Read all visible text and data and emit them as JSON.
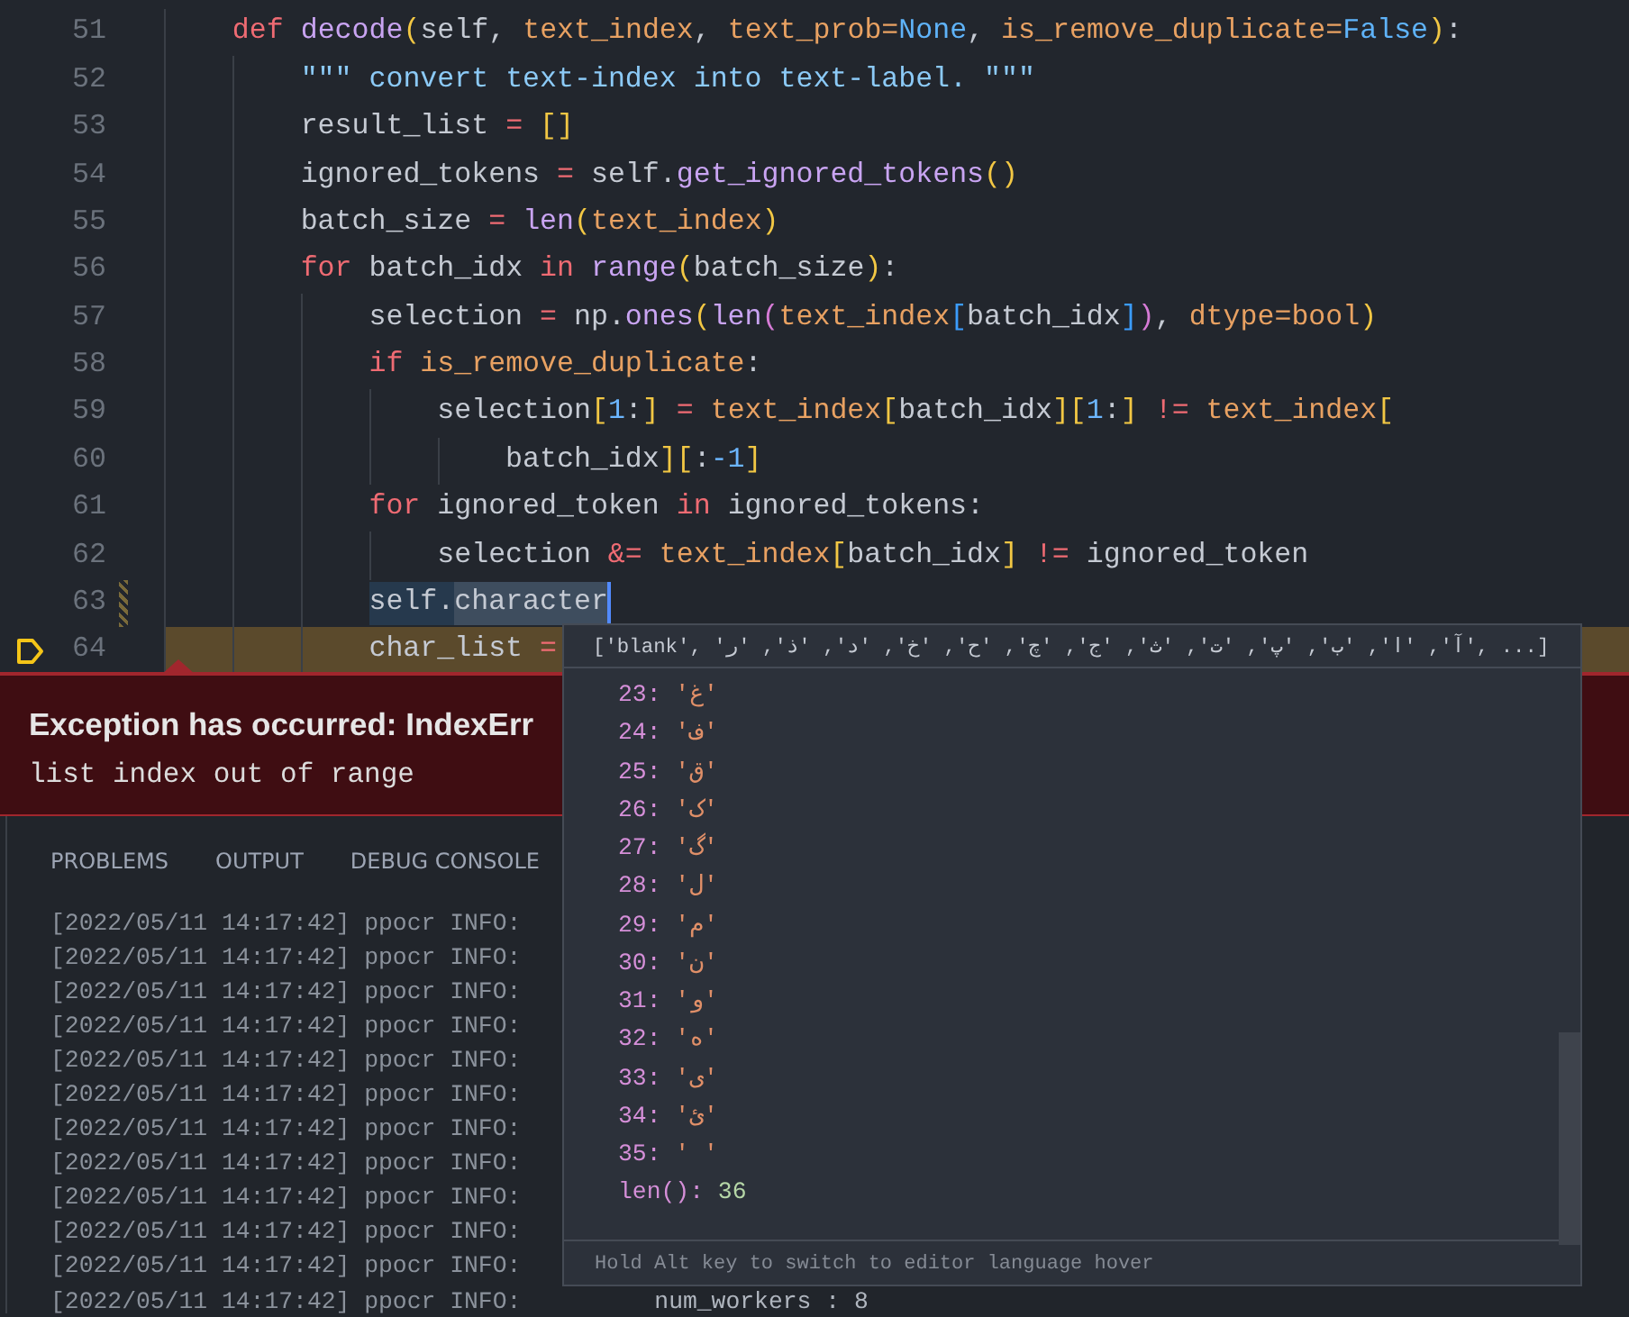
{
  "editor": {
    "lines": [
      {
        "number": "51",
        "modified": false,
        "paused": false,
        "tokens": [
          {
            "text": "def",
            "kind": "kw"
          },
          {
            "text": " decode",
            "kind": "fn"
          },
          {
            "text": "(",
            "kind": "b1"
          },
          {
            "text": "self, ",
            "kind": "plain"
          },
          {
            "text": "text_index",
            "kind": "param"
          },
          {
            "text": ", ",
            "kind": "plain"
          },
          {
            "text": "text_prob=",
            "kind": "param"
          },
          {
            "text": "None",
            "kind": "const"
          },
          {
            "text": ", ",
            "kind": "plain"
          },
          {
            "text": "is_remove_duplicate=",
            "kind": "param"
          },
          {
            "text": "False",
            "kind": "const"
          },
          {
            "text": ")",
            "kind": "b1"
          },
          {
            "text": ":",
            "kind": "plain"
          }
        ],
        "children": [
          {
            "number": "52",
            "modified": false,
            "paused": false,
            "tokens": [
              {
                "text": "\"\"\" convert text-index into text-label. \"\"\"",
                "kind": "str"
              }
            ]
          },
          {
            "number": "53",
            "modified": false,
            "paused": false,
            "tokens": [
              {
                "text": "result_list ",
                "kind": "plain"
              },
              {
                "text": "= ",
                "kind": "op"
              },
              {
                "text": "[]",
                "kind": "b1"
              }
            ]
          },
          {
            "number": "54",
            "modified": false,
            "paused": false,
            "tokens": [
              {
                "text": "ignored_tokens ",
                "kind": "plain"
              },
              {
                "text": "=",
                "kind": "op"
              },
              {
                "text": " self.",
                "kind": "plain"
              },
              {
                "text": "get_ignored_tokens",
                "kind": "fn"
              },
              {
                "text": "()",
                "kind": "b1"
              }
            ]
          },
          {
            "number": "55",
            "modified": false,
            "paused": false,
            "tokens": [
              {
                "text": "batch_size ",
                "kind": "plain"
              },
              {
                "text": "= ",
                "kind": "op"
              },
              {
                "text": "len",
                "kind": "fn"
              },
              {
                "text": "(",
                "kind": "b1"
              },
              {
                "text": "text_index",
                "kind": "param"
              },
              {
                "text": ")",
                "kind": "b1"
              }
            ]
          },
          {
            "number": "56",
            "modified": false,
            "paused": false,
            "tokens": [
              {
                "text": "for",
                "kind": "kw"
              },
              {
                "text": " batch_idx ",
                "kind": "plain"
              },
              {
                "text": "in",
                "kind": "kw"
              },
              {
                "text": " range",
                "kind": "fn"
              },
              {
                "text": "(",
                "kind": "b1"
              },
              {
                "text": "batch_size",
                "kind": "plain"
              },
              {
                "text": ")",
                "kind": "b1"
              },
              {
                "text": ":",
                "kind": "plain"
              }
            ],
            "children": [
              {
                "number": "57",
                "modified": false,
                "paused": false,
                "tokens": [
                  {
                    "text": "selection ",
                    "kind": "plain"
                  },
                  {
                    "text": "=",
                    "kind": "op"
                  },
                  {
                    "text": " np.",
                    "kind": "plain"
                  },
                  {
                    "text": "ones",
                    "kind": "fn"
                  },
                  {
                    "text": "(",
                    "kind": "b1"
                  },
                  {
                    "text": "len",
                    "kind": "fn"
                  },
                  {
                    "text": "(",
                    "kind": "b2"
                  },
                  {
                    "text": "text_index",
                    "kind": "param"
                  },
                  {
                    "text": "[",
                    "kind": "b3"
                  },
                  {
                    "text": "batch_idx",
                    "kind": "plain"
                  },
                  {
                    "text": "]",
                    "kind": "b3"
                  },
                  {
                    "text": ")",
                    "kind": "b2"
                  },
                  {
                    "text": ", ",
                    "kind": "plain"
                  },
                  {
                    "text": "dtype=bool",
                    "kind": "param"
                  },
                  {
                    "text": ")",
                    "kind": "b1"
                  }
                ]
              },
              {
                "number": "58",
                "modified": false,
                "paused": false,
                "tokens": [
                  {
                    "text": "if",
                    "kind": "kw"
                  },
                  {
                    "text": " is_remove_duplicate",
                    "kind": "param"
                  },
                  {
                    "text": ":",
                    "kind": "plain"
                  }
                ],
                "children": [
                  {
                    "number": "59",
                    "modified": false,
                    "paused": false,
                    "tokens": [
                      {
                        "text": "selection",
                        "kind": "plain"
                      },
                      {
                        "text": "[",
                        "kind": "b1"
                      },
                      {
                        "text": "1",
                        "kind": "num"
                      },
                      {
                        "text": ":",
                        "kind": "plain"
                      },
                      {
                        "text": "]",
                        "kind": "b1"
                      },
                      {
                        "text": " = ",
                        "kind": "op"
                      },
                      {
                        "text": "text_index",
                        "kind": "param"
                      },
                      {
                        "text": "[",
                        "kind": "b1"
                      },
                      {
                        "text": "batch_idx",
                        "kind": "plain"
                      },
                      {
                        "text": "][",
                        "kind": "b1"
                      },
                      {
                        "text": "1",
                        "kind": "num"
                      },
                      {
                        "text": ":",
                        "kind": "plain"
                      },
                      {
                        "text": "]",
                        "kind": "b1"
                      },
                      {
                        "text": " != ",
                        "kind": "op"
                      },
                      {
                        "text": "text_index",
                        "kind": "param"
                      },
                      {
                        "text": "[",
                        "kind": "b1"
                      }
                    ],
                    "children": [
                      {
                        "number": "60",
                        "modified": false,
                        "paused": false,
                        "tokens": [
                          {
                            "text": "batch_idx",
                            "kind": "plain"
                          },
                          {
                            "text": "][",
                            "kind": "b1"
                          },
                          {
                            "text": ":",
                            "kind": "plain"
                          },
                          {
                            "text": "-1",
                            "kind": "num"
                          },
                          {
                            "text": "]",
                            "kind": "b1"
                          }
                        ]
                      }
                    ]
                  }
                ]
              },
              {
                "number": "61",
                "modified": false,
                "paused": false,
                "tokens": [
                  {
                    "text": "for",
                    "kind": "kw"
                  },
                  {
                    "text": " ignored_token ",
                    "kind": "plain"
                  },
                  {
                    "text": "in",
                    "kind": "kw"
                  },
                  {
                    "text": " ignored_tokens:",
                    "kind": "plain"
                  }
                ],
                "children": [
                  {
                    "number": "62",
                    "modified": false,
                    "paused": false,
                    "tokens": [
                      {
                        "text": "selection ",
                        "kind": "plain"
                      },
                      {
                        "text": "&= ",
                        "kind": "op"
                      },
                      {
                        "text": "text_index",
                        "kind": "param"
                      },
                      {
                        "text": "[",
                        "kind": "b1"
                      },
                      {
                        "text": "batch_idx",
                        "kind": "plain"
                      },
                      {
                        "text": "]",
                        "kind": "b1"
                      },
                      {
                        "text": " != ",
                        "kind": "op"
                      },
                      {
                        "text": "ignored_token",
                        "kind": "plain"
                      }
                    ]
                  }
                ]
              },
              {
                "number": "63",
                "modified": true,
                "paused": false,
                "tokens": [
                  {
                    "text": "self.",
                    "kind": "hl"
                  },
                  {
                    "text": "character",
                    "kind": "sel"
                  }
                ]
              },
              {
                "number": "64",
                "modified": false,
                "paused": true,
                "tokens": [
                  {
                    "text": "char_list ",
                    "kind": "plain"
                  },
                  {
                    "text": "=",
                    "kind": "op"
                  }
                ]
              }
            ]
          }
        ]
      }
    ]
  },
  "exception": {
    "title": "Exception has occurred: IndexErr",
    "message": "list index out of range"
  },
  "panel": {
    "tabs": [
      "PROBLEMS",
      "OUTPUT",
      "DEBUG CONSOLE"
    ],
    "log": [
      {
        "text": "[2022/05/11 14:17:42] ppocr INFO:"
      },
      {
        "text": "[2022/05/11 14:17:42] ppocr INFO:"
      },
      {
        "text": "[2022/05/11 14:17:42] ppocr INFO:"
      },
      {
        "text": "[2022/05/11 14:17:42] ppocr INFO:"
      },
      {
        "text": "[2022/05/11 14:17:42] ppocr INFO:"
      },
      {
        "text": "[2022/05/11 14:17:42] ppocr INFO:"
      },
      {
        "text": "[2022/05/11 14:17:42] ppocr INFO:"
      },
      {
        "text": "[2022/05/11 14:17:42] ppocr INFO:"
      },
      {
        "text": "[2022/05/11 14:17:42] ppocr INFO:"
      },
      {
        "text": "[2022/05/11 14:17:42] ppocr INFO:"
      },
      {
        "text": "[2022/05/11 14:17:42] ppocr INFO:"
      },
      {
        "text": "[2022/05/11 14:17:42] ppocr INFO:",
        "message": "num_workers : 8"
      }
    ]
  },
  "hover": {
    "summary": "['blank', 'آ', 'ا', 'ب', 'پ', 'ت', 'ث', 'ج', 'چ', 'ح', 'خ', 'د', 'ذ', 'ر', ...]",
    "items": [
      {
        "key": "23:",
        "value": "'غ'"
      },
      {
        "key": "24:",
        "value": "'ف'"
      },
      {
        "key": "25:",
        "value": "'ق'"
      },
      {
        "key": "26:",
        "value": "'ک'"
      },
      {
        "key": "27:",
        "value": "'گ'"
      },
      {
        "key": "28:",
        "value": "'ل'"
      },
      {
        "key": "29:",
        "value": "'م'"
      },
      {
        "key": "30:",
        "value": "'ن'"
      },
      {
        "key": "31:",
        "value": "'و'"
      },
      {
        "key": "32:",
        "value": "'ه'"
      },
      {
        "key": "33:",
        "value": "'ی'"
      },
      {
        "key": "34:",
        "value": "'ئ'"
      },
      {
        "key": "35:",
        "value": "' '"
      }
    ],
    "length": {
      "key": "len():",
      "value": "36"
    },
    "footer": "Hold Alt key to switch to editor language hover"
  }
}
